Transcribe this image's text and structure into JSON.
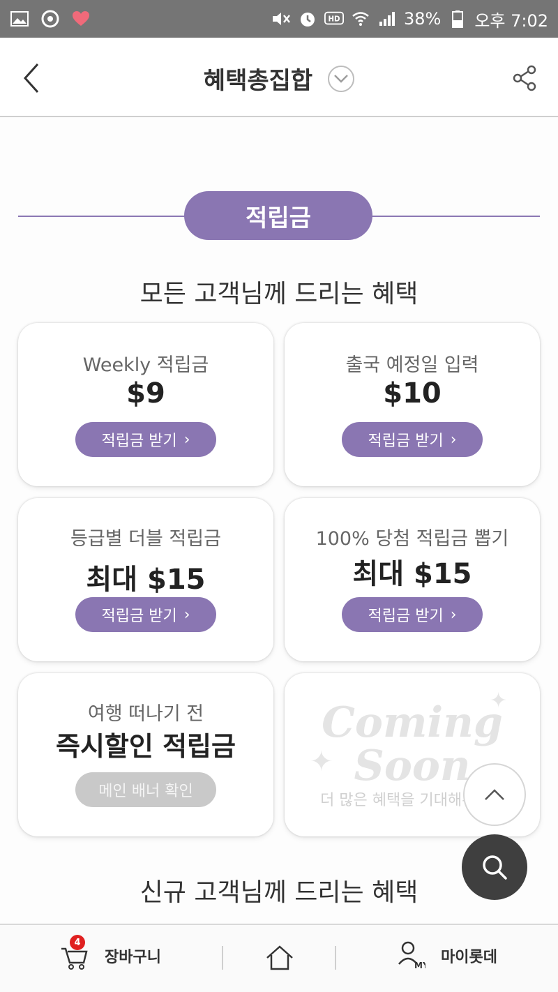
{
  "status_bar": {
    "battery": "38%",
    "time": "오후 7:02"
  },
  "header": {
    "title": "혜택총집합"
  },
  "section": {
    "title": "적립금"
  },
  "group_all": {
    "subtitle": "모든 고객님께 드리는 혜택",
    "cards": [
      {
        "label": "Weekly 적립금",
        "value": "$9",
        "button": "적립금 받기"
      },
      {
        "label": "출국 예정일 입력",
        "value": "$10",
        "button": "적립금 받기"
      },
      {
        "label": "등급별 더블 적립금",
        "value": "최대 $15",
        "button": "적립금 받기"
      },
      {
        "label": "100% 당첨 적립금 뽑기",
        "value": "최대 $15",
        "button": "적립금 받기"
      },
      {
        "label": "여행 떠나기 전",
        "value": "즉시할인 적립금",
        "button": "메인 배너 확인"
      }
    ],
    "coming_soon": {
      "line1": "Coming",
      "line2": "Soon",
      "sub": "더 많은 혜택을 기대해주세요"
    }
  },
  "group_new": {
    "subtitle": "신규 고객님께 드리는 혜택"
  },
  "bottom_nav": {
    "cart_label": "장바구니",
    "cart_count": "4",
    "my_label": "마이롯데",
    "my_badge": "MY"
  },
  "colors": {
    "accent": "#8a76b2",
    "status_bar": "#757575",
    "fab": "#3f3f3f"
  }
}
